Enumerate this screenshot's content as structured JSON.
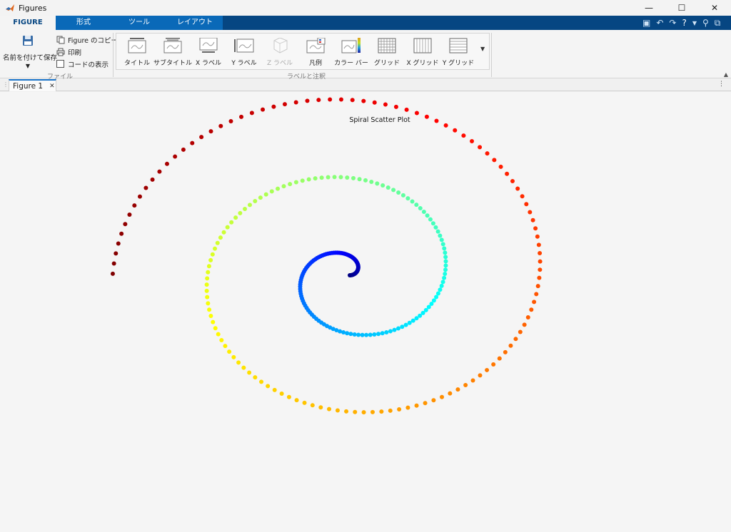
{
  "window": {
    "title": "Figures",
    "controls": {
      "minimize": "—",
      "maximize": "☐",
      "close": "✕"
    }
  },
  "ribbon_tabs": [
    "FIGURE",
    "形式",
    "ツール",
    "レイアウト"
  ],
  "file_section": {
    "save_as": "名前を付けて保存",
    "copy_figure": "Figure のコピー",
    "print": "印刷",
    "show_code": "コードの表示",
    "section_label": "ファイル"
  },
  "labels_section": {
    "section_label": "ラベルと注釈",
    "tools": [
      "タイトル",
      "サブタイトル",
      "X ラベル",
      "Y ラベル",
      "Z ラベル",
      "凡例",
      "カラー バー",
      "グリッド",
      "X グリッド",
      "Y グリッド"
    ]
  },
  "document_tab": {
    "label": "Figure 1",
    "close": "✕"
  },
  "chart_data": {
    "type": "scatter",
    "title": "Spiral Scatter Plot",
    "formula": "r = theta, x = r*cos(theta), y = r*sin(theta)",
    "theta_range": [
      0,
      15.7
    ],
    "n_points": 300,
    "color_by": "theta",
    "colormap": "jet",
    "axes_visible": false,
    "xlim": [
      -12.6,
      15.7
    ],
    "ylim": [
      -15.7,
      15.7
    ]
  }
}
